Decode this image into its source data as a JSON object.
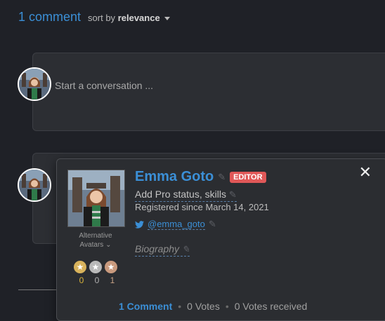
{
  "header": {
    "count_label": "1 comment",
    "sort_prefix": "sort by",
    "sort_value": "relevance"
  },
  "composer": {
    "placeholder": "Start a conversation ..."
  },
  "popup": {
    "name": "Emma Goto",
    "badge": "EDITOR",
    "headline": "Add Pro status, skills",
    "registered": "Registered since March 14, 2021",
    "twitter": "@emma_goto",
    "biography": "Biography",
    "alternative_avatars": "Alternative",
    "avatars_label": "Avatars",
    "medals": {
      "gold": "0",
      "silver": "0",
      "bronze": "1"
    },
    "stats": {
      "comments": "1 Comment",
      "votes": "0 Votes",
      "votes_received": "0 Votes received"
    },
    "close_glyph": "✕"
  },
  "colors": {
    "accent": "#3b8fd6",
    "badge": "#e05858",
    "background": "#1f2127"
  }
}
